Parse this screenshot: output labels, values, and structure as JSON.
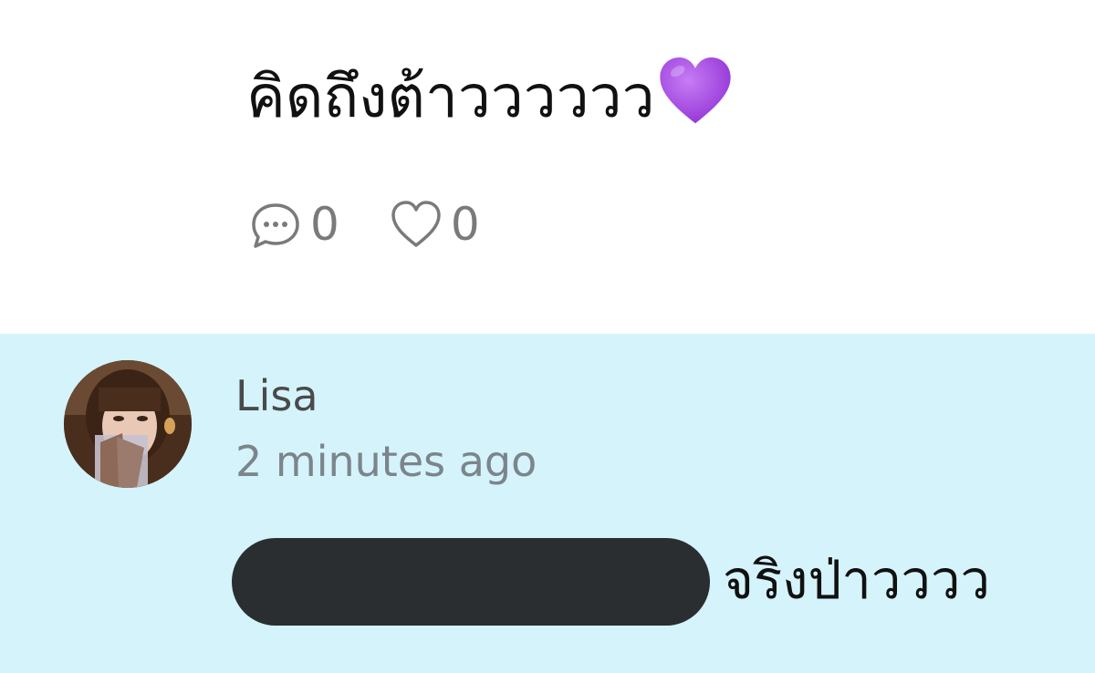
{
  "post": {
    "text": "คิดถึงต้าวววววว",
    "emoji": "purple-heart-emoji",
    "comment_icon": "comment-icon",
    "comment_count": "0",
    "like_icon": "heart-outline-icon",
    "like_count": "0"
  },
  "reply": {
    "author": "Lisa",
    "timestamp": "2 minutes ago",
    "text": "จริงป่าวววว",
    "mention_redacted": true
  },
  "colors": {
    "reply_background": "#d5f3fb",
    "emoji_purple": "#a64ee6",
    "icon_gray": "#7a7a7a",
    "redaction": "#2a2e30"
  }
}
